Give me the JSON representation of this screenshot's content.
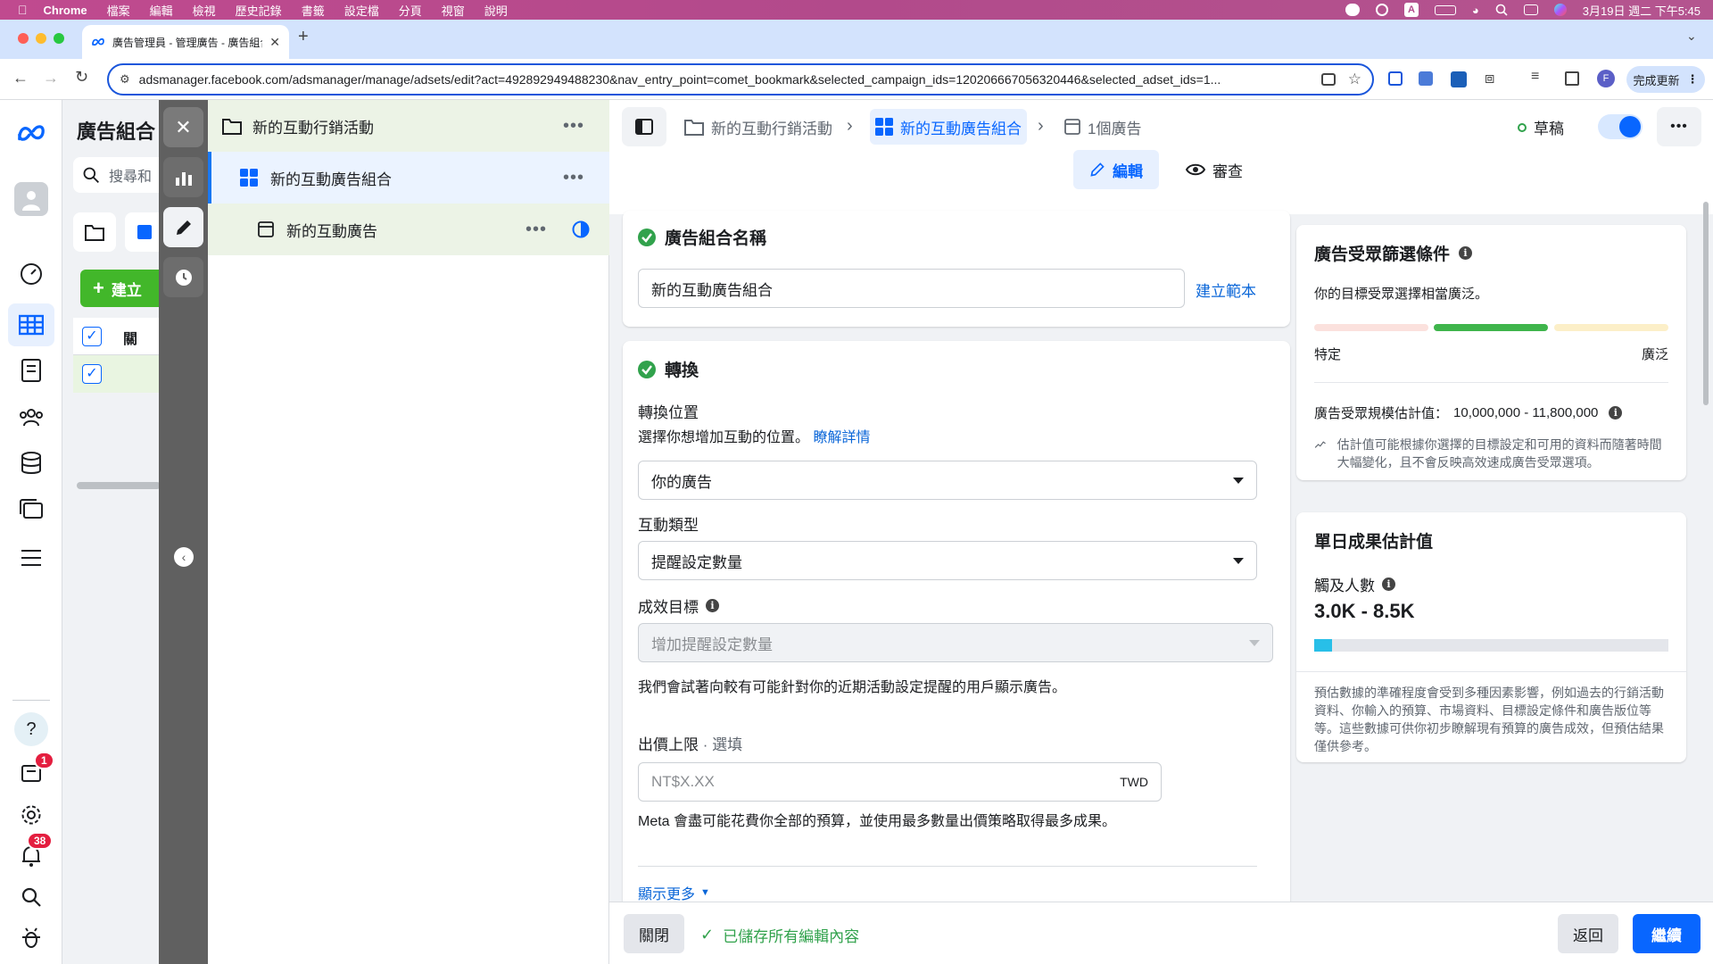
{
  "menubar": {
    "items": [
      "Chrome",
      "檔案",
      "編輯",
      "檢視",
      "歷史記錄",
      "書籤",
      "設定檔",
      "分頁",
      "視窗",
      "說明"
    ],
    "datetime": "3月19日 週二 下午5:45"
  },
  "browser": {
    "tab_title": "廣告管理員 - 管理廣告 - 廣告組合",
    "url": "adsmanager.facebook.com/adsmanager/manage/adsets/edit?act=492892949488230&nav_entry_point=comet_bookmark&selected_campaign_ids=120206667056320446&selected_adset_ids=1...",
    "update_label": "完成更新",
    "profile_initial": "F"
  },
  "rail": {
    "notifications_badge": "1",
    "alerts_badge": "38"
  },
  "tablepanel": {
    "title": "廣告組合",
    "search_placeholder": "搜尋和",
    "create_label": "建立",
    "col_header": "關"
  },
  "tree": {
    "campaign": "新的互動行銷活動",
    "adset": "新的互動廣告組合",
    "ad": "新的互動廣告"
  },
  "breadcrumb": {
    "campaign": "新的互動行銷活動",
    "adset": "新的互動廣告組合",
    "ads": "1個廣告",
    "status": "草稿"
  },
  "mode_tabs": {
    "edit": "編輯",
    "review": "審查"
  },
  "name_card": {
    "title": "廣告組合名稱",
    "value": "新的互動廣告組合",
    "template_link": "建立範本"
  },
  "conversion_card": {
    "title": "轉換",
    "location_label": "轉換位置",
    "location_help": "選擇你想增加互動的位置。",
    "learn_more": "瞭解詳情",
    "location_value": "你的廣告",
    "engagement_label": "互動類型",
    "engagement_value": "提醒設定數量",
    "goal_label": "成效目標",
    "goal_value": "增加提醒設定數量",
    "goal_desc": "我們會試著向較有可能針對你的近期活動設定提醒的用戶顯示廣告。",
    "bid_label": "出價上限",
    "bid_optional": "· 選填",
    "bid_placeholder": "NT$X.XX",
    "bid_currency": "TWD",
    "bid_desc": "Meta 會盡可能花費你全部的預算，並使用最多數量出價策略取得最多成果。",
    "show_more": "顯示更多"
  },
  "audience_card": {
    "title": "廣告受眾篩選條件",
    "summary": "你的目標受眾選擇相當廣泛。",
    "left_label": "特定",
    "right_label": "廣泛",
    "size_label": "廣告受眾規模估計值：",
    "size_value": "10,000,000 - 11,800,000",
    "note": "估計值可能根據你選擇的目標設定和可用的資料而隨著時間大幅變化，且不會反映高效速成廣告受眾選項。"
  },
  "results_card": {
    "title": "單日成果估計值",
    "reach_label": "觸及人數",
    "reach_value": "3.0K - 8.5K",
    "reach_fill": 0.05,
    "note": "預估數據的準確程度會受到多種因素影響，例如過去的行銷活動資料、你輸入的預算、市場資料、目標設定條件和廣告版位等等。這些數據可供你初步瞭解現有預算的廣告成效，但預估結果僅供參考。"
  },
  "footer": {
    "close": "關閉",
    "saved": "已儲存所有編輯內容",
    "back": "返回",
    "continue": "繼續"
  },
  "colors": {
    "accent": "#0866ff",
    "success": "#31a24c",
    "menubar": "#b24a8b"
  }
}
